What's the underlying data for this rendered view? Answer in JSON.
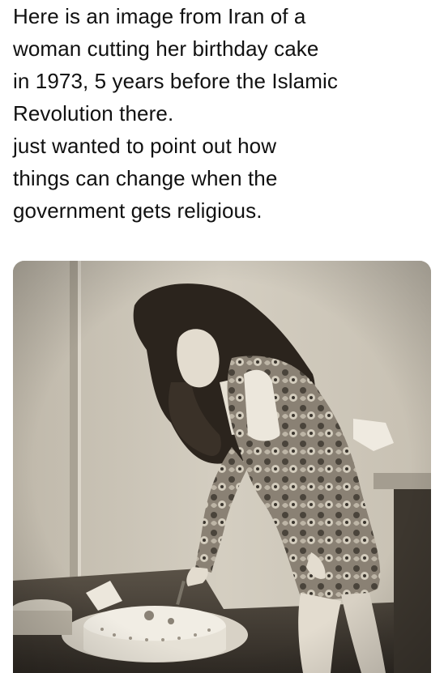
{
  "post": {
    "lines": [
      "Here is an image from Iran of a",
      "woman cutting her birthday cake",
      "in 1973, 5 years before the Islamic",
      "Revolution there.",
      "just wanted to point out how",
      "things can change when the",
      "government gets religious."
    ]
  },
  "photo": {
    "tone": "sepia"
  },
  "colors": {
    "background": "#ffffff",
    "text": "#111111",
    "photo_wall": "#c9c2b4",
    "photo_dark": "#2b2620"
  }
}
